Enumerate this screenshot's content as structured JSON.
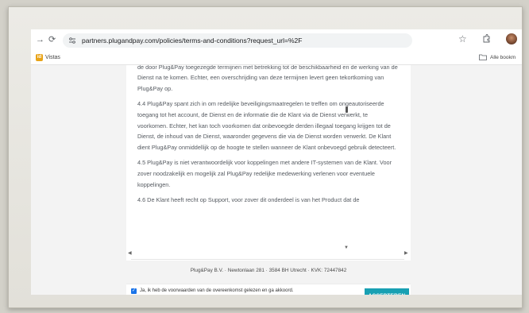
{
  "browser": {
    "url": "partners.plugandpay.com/policies/terms-and-conditions?request_url=%2F",
    "bookmark_left": "Vistas",
    "bookmark_right": "Alle bookm"
  },
  "terms": {
    "paragraphs": [
      "tussen nagaan gegevens van derden en de opslag daarvan op de Dienst. Plug&Pay spant zich in om de door Plug&Pay toegezegde termijnen met betrekking tot de beschikbaarheid en de werking van de Dienst na te komen. Echter, een overschrijding van deze termijnen levert geen tekortkoming van Plug&Pay op.",
      "4.4 Plug&Pay spant zich in om redelijke beveiligingsmaatregelen te treffen om ongeautoriseerde toegang tot het account, de Dienst en de informatie die de Klant via de Dienst verwerkt, te voorkomen. Echter, het kan toch voorkomen dat onbevoegde derden illegaal toegang krijgen tot de Dienst, de inhoud van de Dienst, waaronder gegevens die via de Dienst worden verwerkt. De Klant dient Plug&Pay onmiddellijk op de hoogte te stellen wanneer de Klant onbevoegd gebruik detecteert.",
      "4.5 Plug&Pay is niet verantwoordelijk voor koppelingen met andere IT-systemen van de Klant. Voor zover noodzakelijk en mogelijk zal Plug&Pay redelijke medewerking verlenen voor eventuele koppelingen.",
      "4.6 De Klant heeft recht op Support, voor zover dit onderdeel is van het Product dat de"
    ]
  },
  "footer": {
    "address": "Plug&Pay B.V. · Newtonlaan 281 · 3584 BH Utrecht · KVK: 72447842"
  },
  "consent": {
    "label": "Ja, ik heb de voorwaarden van de overeenkomst gelezen en ga akkoord.",
    "checked": true,
    "button": "ACCEPTEREN"
  },
  "colors": {
    "accent": "#18a0b3",
    "checkbox": "#1a73e8"
  }
}
